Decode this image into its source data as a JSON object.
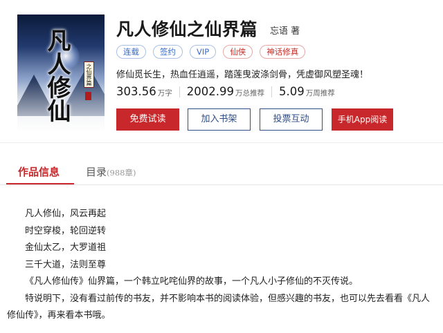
{
  "book": {
    "cover": {
      "title": "凡人修仙",
      "subtitle": "之仙界篇"
    },
    "title": "凡人修仙之仙界篇",
    "author": "忘语 著",
    "tags": [
      {
        "label": "连载",
        "color": "#3a6bc8"
      },
      {
        "label": "签约",
        "color": "#3a6bc8"
      },
      {
        "label": "VIP",
        "color": "#3a6bc8"
      },
      {
        "label": "仙侠",
        "color": "#c4302b"
      },
      {
        "label": "神话修真",
        "color": "#c4302b"
      }
    ],
    "intro": "修仙觅长生，热血任逍遥，踏莲曳波涤剑骨，凭虚御风塑圣魂！",
    "stats": [
      {
        "value": "303.56",
        "unit": "万字"
      },
      {
        "value": "2002.99",
        "unit": "万总推荐"
      },
      {
        "value": "5.09",
        "unit": "万周推荐"
      }
    ]
  },
  "actions": {
    "free_read": "免费试读",
    "add_shelf": "加入书架",
    "vote": "投票互动",
    "app_read": "手机App阅读"
  },
  "tabs": {
    "info": "作品信息",
    "toc": "目录",
    "toc_count": "(988章)"
  },
  "description": [
    "凡人修仙，风云再起",
    "时空穿梭，轮回逆转",
    "金仙太乙，大罗道祖",
    "三千大道，法则至尊",
    "《凡人修仙传》仙界篇，一个韩立叱咤仙界的故事，一个凡人小子修仙的不灭传说。",
    "特说明下，没有看过前传的书友，并不影响本书的阅读体验，但感兴趣的书友，也可以先去看看《凡人修仙传》，再来看本书哦。"
  ],
  "colors": {
    "accent_red": "#c8282b",
    "accent_blue": "#2f4d87"
  }
}
